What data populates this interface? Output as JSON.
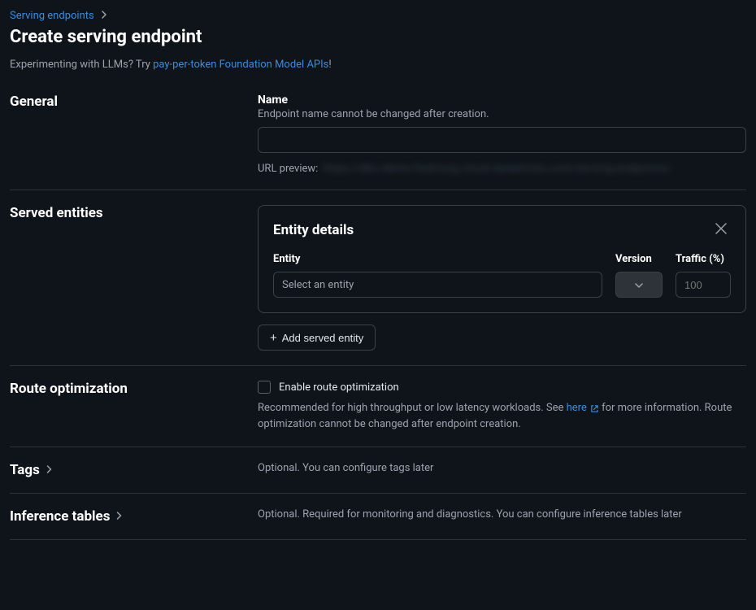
{
  "breadcrumb": {
    "parent": "Serving endpoints"
  },
  "page_title": "Create serving endpoint",
  "experiment": {
    "prefix": "Experimenting with LLMs? Try ",
    "link": "pay-per-token Foundation Model APIs",
    "suffix": "!"
  },
  "general": {
    "title": "General",
    "name_label": "Name",
    "name_hint": "Endpoint name cannot be changed after creation.",
    "name_value": "",
    "url_preview_label": "URL preview:",
    "url_preview_blurred": "https://dbc-demo-field-eng.cloud.databricks.com/serving-endpoints/"
  },
  "served": {
    "title": "Served entities",
    "card_title": "Entity details",
    "entity_label": "Entity",
    "entity_placeholder": "Select an entity",
    "version_label": "Version",
    "traffic_label": "Traffic (%)",
    "traffic_placeholder": "100",
    "add_button": "Add served entity"
  },
  "route": {
    "title": "Route optimization",
    "checkbox_label": "Enable route optimization",
    "desc_prefix": "Recommended for high throughput or low latency workloads. See ",
    "desc_link": "here",
    "desc_suffix": " for more information. Route optimization cannot be changed after endpoint creation."
  },
  "tags": {
    "title": "Tags",
    "desc": "Optional. You can configure tags later"
  },
  "inference": {
    "title": "Inference tables",
    "desc": "Optional. Required for monitoring and diagnostics. You can configure inference tables later"
  }
}
